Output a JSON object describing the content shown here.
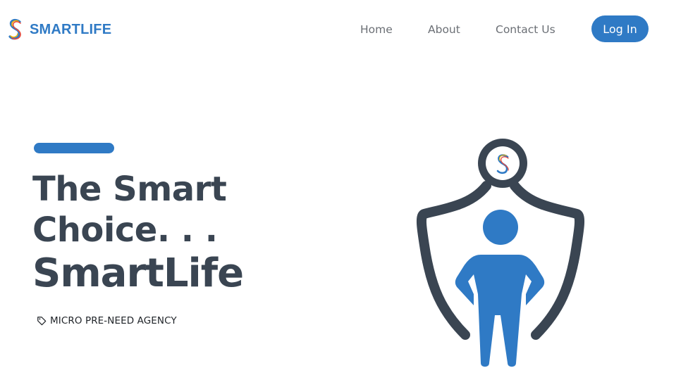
{
  "brand": {
    "name": "SMARTLIFE",
    "logo_icon": "smartlife-s-logo-icon",
    "color": "#2f7ac5"
  },
  "nav": {
    "items": [
      {
        "label": "Home"
      },
      {
        "label": "About"
      },
      {
        "label": "Contact Us"
      }
    ],
    "login_label": "Log In"
  },
  "hero": {
    "title_line1": "The Smart",
    "title_line2": "Choice. . .",
    "title_line3": "SmartLife",
    "tagline": "MICRO PRE-NEED AGENCY",
    "tagline_icon": "tag-icon",
    "illustration_icon": "shield-person-icon"
  },
  "colors": {
    "primary": "#2f7ac5",
    "dark": "#3a4552",
    "nav_text": "#6b6f75"
  }
}
